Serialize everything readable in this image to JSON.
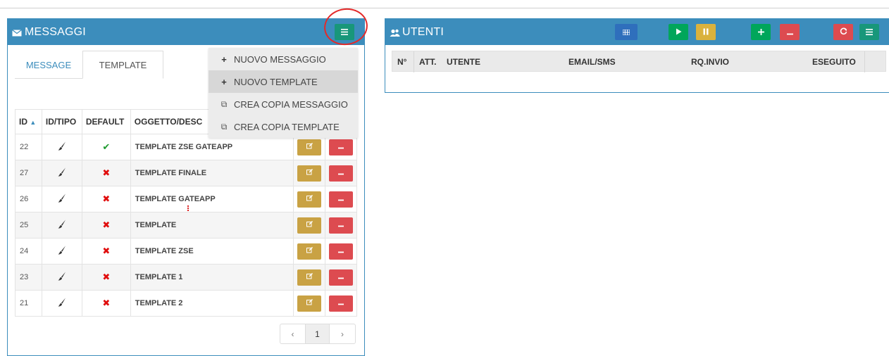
{
  "messaggi": {
    "title": "MESSAGGI",
    "header_icon": "envelope-icon",
    "menu_button_icon": "bars-icon",
    "tabs": [
      {
        "label": "MESSAGE",
        "active": false
      },
      {
        "label": "TEMPLATE",
        "active": true
      }
    ],
    "dropdown": [
      {
        "icon": "plus-icon",
        "label": "NUOVO MESSAGGIO"
      },
      {
        "icon": "plus-icon",
        "label": "NUOVO TEMPLATE"
      },
      {
        "icon": "copy-icon",
        "label": "CREA COPIA MESSAGGIO"
      },
      {
        "icon": "copy-icon",
        "label": "CREA COPIA TEMPLATE"
      }
    ],
    "columns": [
      "ID",
      "ID/TIPO",
      "DEFAULT",
      "OGGETTO/DESC"
    ],
    "rows": [
      {
        "id": "22",
        "default": true,
        "desc": "TEMPLATE ZSE GATEAPP"
      },
      {
        "id": "27",
        "default": false,
        "desc": "TEMPLATE FINALE"
      },
      {
        "id": "26",
        "default": false,
        "desc": "TEMPLATE GATEAPP"
      },
      {
        "id": "25",
        "default": false,
        "desc": "TEMPLATE"
      },
      {
        "id": "24",
        "default": false,
        "desc": "TEMPLATE ZSE"
      },
      {
        "id": "23",
        "default": false,
        "desc": "TEMPLATE 1"
      },
      {
        "id": "21",
        "default": false,
        "desc": "TEMPLATE 2"
      }
    ],
    "pagination": {
      "prev": "‹",
      "page": "1",
      "next": "›"
    }
  },
  "utenti": {
    "title": "UTENTI",
    "header_icon": "users-icon",
    "columns": [
      "N°",
      "ATT.",
      "UTENTE",
      "EMAIL/SMS",
      "RQ.INVIO",
      "ESEGUITO"
    ]
  },
  "colors": {
    "panel_header": "#3c8dbc",
    "teal": "#18977a",
    "green": "#00a65a",
    "blue": "#2f6fbc",
    "yellow": "#dab23d",
    "red": "#dd4b50",
    "annotation_circle": "#e32a2a"
  }
}
